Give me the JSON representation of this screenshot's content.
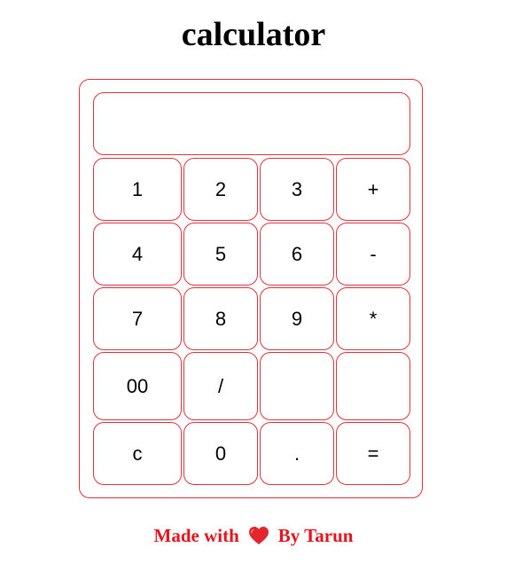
{
  "title": "calculator",
  "display": {
    "value": ""
  },
  "keys": {
    "k1": "1",
    "k2": "2",
    "k3": "3",
    "plus": "+",
    "k4": "4",
    "k5": "5",
    "k6": "6",
    "minus": "-",
    "k7": "7",
    "k8": "8",
    "k9": "9",
    "multiply": "*",
    "k00": "00",
    "divide": "/",
    "blank1": "",
    "blank2": "",
    "clear": "c",
    "k0": "0",
    "dot": ".",
    "equals": "="
  },
  "footer": {
    "made_with": "Made with",
    "icon": "heart-icon",
    "by": "By Tarun"
  },
  "colors": {
    "border": "#e0323c",
    "footer_text": "#e8121c",
    "heart": "#e3262e"
  }
}
